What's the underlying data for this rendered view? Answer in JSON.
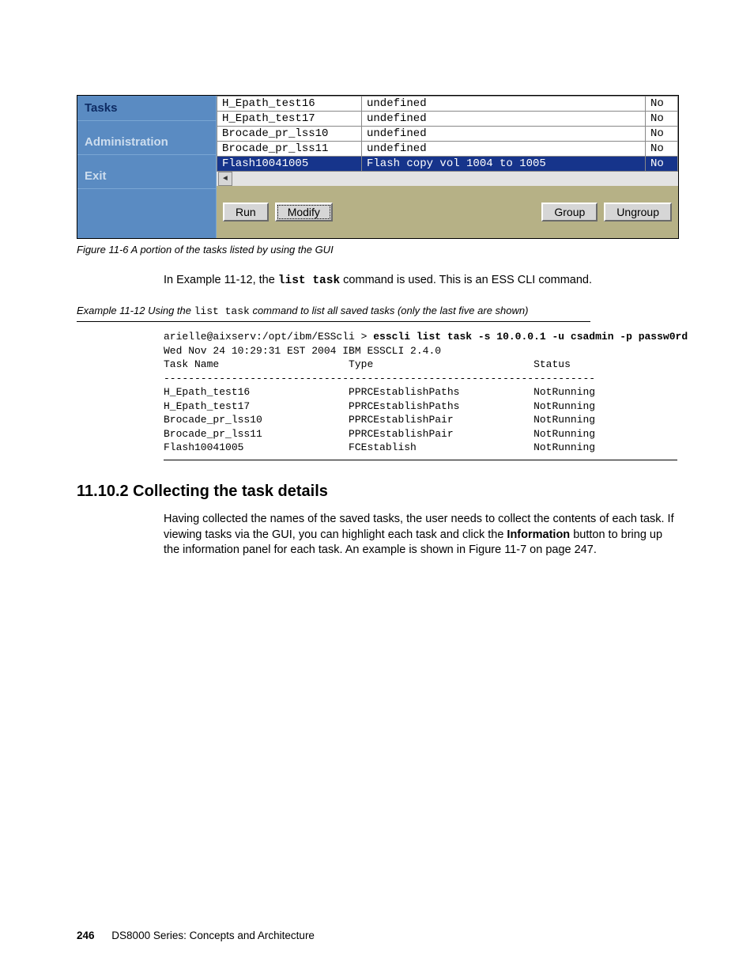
{
  "gui": {
    "nav": [
      {
        "label": "Tasks",
        "active": true
      },
      {
        "label": "Administration",
        "active": false
      },
      {
        "label": "Exit",
        "active": false
      }
    ],
    "rows": [
      {
        "task": "H_Epath_test16",
        "desc": "undefined",
        "no": "No",
        "selected": false
      },
      {
        "task": "H_Epath_test17",
        "desc": "undefined",
        "no": "No",
        "selected": false
      },
      {
        "task": "Brocade_pr_lss10",
        "desc": "undefined",
        "no": "No",
        "selected": false
      },
      {
        "task": "Brocade_pr_lss11",
        "desc": "undefined",
        "no": "No",
        "selected": false
      },
      {
        "task": "Flash10041005",
        "desc": "Flash copy vol 1004 to 1005",
        "no": "No",
        "selected": true
      }
    ],
    "buttons": {
      "run": "Run",
      "modify": "Modify",
      "group": "Group",
      "ungroup": "Ungroup"
    }
  },
  "figure_caption": "Figure 11-6   A portion of the tasks listed by using the GUI",
  "para1_pre": "In Example 11-12, the ",
  "para1_cmd": "list task",
  "para1_post": " command is used. This is an ESS CLI command.",
  "example_caption_pre": "Example 11-12   Using the ",
  "example_caption_cmd": "list task",
  "example_caption_post": " command to list all saved tasks (only the last five are shown)",
  "cli": {
    "prompt": "arielle@aixserv:/opt/ibm/ESScli > ",
    "command": "esscli list task -s 10.0.0.1 -u csadmin -p passw0rd",
    "line2": "Wed Nov 24 10:29:31 EST 2004 IBM ESSCLI 2.4.0",
    "header": "Task Name                     Type                          Status",
    "sep": "----------------------------------------------------------------------",
    "rows": [
      "H_Epath_test16                PPRCEstablishPaths            NotRunning",
      "H_Epath_test17                PPRCEstablishPaths            NotRunning",
      "Brocade_pr_lss10              PPRCEstablishPair             NotRunning",
      "Brocade_pr_lss11              PPRCEstablishPair             NotRunning",
      "Flash10041005                 FCEstablish                   NotRunning"
    ]
  },
  "section_heading": "11.10.2  Collecting the task details",
  "para2_a": "Having collected the names of the saved tasks, the user needs to collect the contents of each task. If viewing tasks via the GUI, you can highlight each task and click the ",
  "para2_bold": "Information",
  "para2_b": " button to bring up the information panel for each task. An example is shown in Figure 11-7 on page 247.",
  "footer_page": "246",
  "footer_title": "DS8000 Series: Concepts and Architecture"
}
